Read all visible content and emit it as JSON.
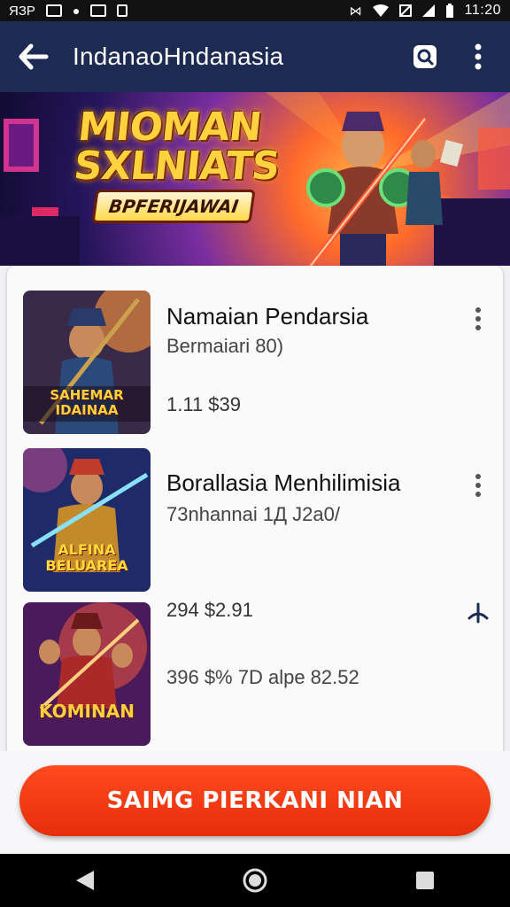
{
  "status_bar": {
    "time": "11:20",
    "carrier_text": "ЯЗP"
  },
  "app_bar": {
    "title": "IndanaoHndanasia",
    "back_icon": "arrow-left-icon",
    "search_icon": "search-icon",
    "more_icon": "more-vertical-icon"
  },
  "hero": {
    "title_line1": "MIOMAN",
    "title_line2": "SXLNIATS",
    "badge": "BPFERIJAWAI"
  },
  "games": [
    {
      "title": "Namaian Pendarsia",
      "subtitle": "Bermaiari 80)",
      "meta": "1.11 $39",
      "thumb_text": "SAHEMAR IDAINAA"
    },
    {
      "title": "Borallasia Menhilimisia",
      "subtitle": "73nhannai 1Д J2a0/",
      "meta": "",
      "thumb_text": "ALFINA BELUAREA"
    },
    {
      "title": "",
      "subtitle": "396 $% 7D alpe 82.52",
      "meta": "294 $2.91",
      "thumb_text": "KOMINAN"
    }
  ],
  "cta": {
    "label": "SAIMG PIERKANI NIAN"
  },
  "colors": {
    "app_bar": "#1d2b52",
    "cta": "#f13a14",
    "background": "#f1f1f4"
  }
}
